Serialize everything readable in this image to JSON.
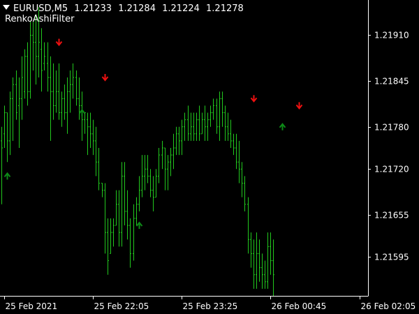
{
  "header": {
    "symbol_timeframe": "EURUSD,M5",
    "open": "1.21233",
    "high": "1.21284",
    "low": "1.21224",
    "close": "1.21278"
  },
  "indicator": {
    "name": "RenkoAshiFilter"
  },
  "colors": {
    "background": "#000000",
    "axis": "#ffffff",
    "text": "#ffffff",
    "bar": "#22c91e",
    "arrow_up": "#0d8a17",
    "arrow_down": "#ee1010"
  },
  "chart_data": {
    "type": "ohlc",
    "ylim": [
      1.2154,
      1.2196
    ],
    "y_ticks": [
      "1.21910",
      "1.21845",
      "1.21780",
      "1.21720",
      "1.21655",
      "1.21595"
    ],
    "x_tick_labels": [
      "25 Feb 2021",
      "25 Feb 22:05",
      "25 Feb 23:25",
      "26 Feb 00:45",
      "26 Feb 02:05"
    ],
    "x_tick_bar_index": [
      1,
      32,
      63,
      94,
      125
    ],
    "grid": false,
    "bars": [
      [
        1.2176,
        1.2178,
        1.2167,
        1.2175
      ],
      [
        1.2177,
        1.2181,
        1.2175,
        1.218
      ],
      [
        1.218,
        1.218,
        1.2173,
        1.2176
      ],
      [
        1.2176,
        1.2183,
        1.2174,
        1.2182
      ],
      [
        1.2182,
        1.2185,
        1.2176,
        1.2184
      ],
      [
        1.2184,
        1.2186,
        1.2179,
        1.218
      ],
      [
        1.2181,
        1.2185,
        1.2175,
        1.2182
      ],
      [
        1.2182,
        1.2188,
        1.2179,
        1.2185
      ],
      [
        1.2183,
        1.2189,
        1.2182,
        1.2188
      ],
      [
        1.2188,
        1.219,
        1.2181,
        1.2183
      ],
      [
        1.2183,
        1.2193,
        1.2182,
        1.2191
      ],
      [
        1.2191,
        1.2193,
        1.2186,
        1.219
      ],
      [
        1.219,
        1.2194,
        1.2184,
        1.2188
      ],
      [
        1.2188,
        1.2195,
        1.2185,
        1.219
      ],
      [
        1.2189,
        1.2192,
        1.2183,
        1.2186
      ],
      [
        1.2187,
        1.219,
        1.2186,
        1.2188
      ],
      [
        1.2187,
        1.219,
        1.2183,
        1.2185
      ],
      [
        1.2185,
        1.2188,
        1.2176,
        1.2183
      ],
      [
        1.2183,
        1.2187,
        1.2179,
        1.2181
      ],
      [
        1.2181,
        1.2186,
        1.218,
        1.2183
      ],
      [
        1.2183,
        1.2187,
        1.2179,
        1.218
      ],
      [
        1.218,
        1.2183,
        1.2178,
        1.2182
      ],
      [
        1.2182,
        1.2184,
        1.2179,
        1.218
      ],
      [
        1.218,
        1.2185,
        1.2177,
        1.2183
      ],
      [
        1.2183,
        1.2186,
        1.218,
        1.2184
      ],
      [
        1.2184,
        1.2187,
        1.2182,
        1.2185
      ],
      [
        1.2185,
        1.2186,
        1.2181,
        1.2182
      ],
      [
        1.2182,
        1.2185,
        1.2179,
        1.2181
      ],
      [
        1.2181,
        1.2183,
        1.2176,
        1.2179
      ],
      [
        1.2179,
        1.218,
        1.2177,
        1.218
      ],
      [
        1.2179,
        1.218,
        1.2174,
        1.2178
      ],
      [
        1.2178,
        1.218,
        1.2175,
        1.2177
      ],
      [
        1.2177,
        1.2179,
        1.2174,
        1.2176
      ],
      [
        1.2176,
        1.2178,
        1.2171,
        1.2173
      ],
      [
        1.2173,
        1.2175,
        1.2169,
        1.217
      ],
      [
        1.217,
        1.217,
        1.2168,
        1.2169
      ],
      [
        1.2169,
        1.217,
        1.216,
        1.2163
      ],
      [
        1.2163,
        1.2165,
        1.2157,
        1.2159
      ],
      [
        1.216,
        1.2165,
        1.216,
        1.2163
      ],
      [
        1.2163,
        1.2165,
        1.2161,
        1.2164
      ],
      [
        1.2164,
        1.2169,
        1.2164,
        1.2167
      ],
      [
        1.2167,
        1.2169,
        1.2161,
        1.2163
      ],
      [
        1.2163,
        1.2173,
        1.2161,
        1.2171
      ],
      [
        1.2171,
        1.2173,
        1.2164,
        1.2166
      ],
      [
        1.2166,
        1.2169,
        1.2162,
        1.2164
      ],
      [
        1.2164,
        1.2165,
        1.2158,
        1.216
      ],
      [
        1.216,
        1.2167,
        1.2159,
        1.2165
      ],
      [
        1.2165,
        1.2168,
        1.2164,
        1.2167
      ],
      [
        1.2167,
        1.2171,
        1.2166,
        1.2169
      ],
      [
        1.2169,
        1.2174,
        1.2168,
        1.2171
      ],
      [
        1.2171,
        1.2174,
        1.2169,
        1.2172
      ],
      [
        1.2172,
        1.2174,
        1.217,
        1.2171
      ],
      [
        1.2171,
        1.2172,
        1.2168,
        1.2169
      ],
      [
        1.2169,
        1.2171,
        1.2166,
        1.2168
      ],
      [
        1.2168,
        1.2172,
        1.2168,
        1.2171
      ],
      [
        1.2171,
        1.2175,
        1.217,
        1.2174
      ],
      [
        1.2174,
        1.2176,
        1.2172,
        1.2175
      ],
      [
        1.2175,
        1.2175,
        1.2169,
        1.2172
      ],
      [
        1.2172,
        1.2174,
        1.2169,
        1.2173
      ],
      [
        1.2173,
        1.2175,
        1.2171,
        1.2174
      ],
      [
        1.2174,
        1.2177,
        1.2172,
        1.2175
      ],
      [
        1.2175,
        1.2178,
        1.2174,
        1.2177
      ],
      [
        1.2177,
        1.2178,
        1.2174,
        1.2176
      ],
      [
        1.2176,
        1.2179,
        1.2174,
        1.2178
      ],
      [
        1.2178,
        1.218,
        1.2176,
        1.2179
      ],
      [
        1.2179,
        1.2181,
        1.2176,
        1.2177
      ],
      [
        1.2177,
        1.218,
        1.2176,
        1.2178
      ],
      [
        1.2178,
        1.218,
        1.2176,
        1.2177
      ],
      [
        1.2177,
        1.218,
        1.2176,
        1.2179
      ],
      [
        1.2179,
        1.2181,
        1.2176,
        1.2177
      ],
      [
        1.2177,
        1.218,
        1.2177,
        1.2179
      ],
      [
        1.2179,
        1.2181,
        1.2176,
        1.2178
      ],
      [
        1.2178,
        1.218,
        1.2176,
        1.2179
      ],
      [
        1.2179,
        1.2181,
        1.2178,
        1.218
      ],
      [
        1.218,
        1.2182,
        1.2179,
        1.2181
      ],
      [
        1.2181,
        1.2182,
        1.2177,
        1.2178
      ],
      [
        1.2178,
        1.2183,
        1.2176,
        1.2182
      ],
      [
        1.2182,
        1.2183,
        1.2178,
        1.218
      ],
      [
        1.218,
        1.2181,
        1.2176,
        1.2178
      ],
      [
        1.2178,
        1.218,
        1.2176,
        1.2177
      ],
      [
        1.2177,
        1.2179,
        1.2175,
        1.2176
      ],
      [
        1.2176,
        1.2177,
        1.2174,
        1.2175
      ],
      [
        1.2175,
        1.2177,
        1.2172,
        1.2173
      ],
      [
        1.2173,
        1.2176,
        1.217,
        1.2172
      ],
      [
        1.2172,
        1.2173,
        1.2168,
        1.217
      ],
      [
        1.217,
        1.2171,
        1.2166,
        1.2167
      ],
      [
        1.2167,
        1.2168,
        1.216,
        1.2162
      ],
      [
        1.2162,
        1.2163,
        1.2158,
        1.216
      ],
      [
        1.216,
        1.2162,
        1.2155,
        1.2157
      ],
      [
        1.2157,
        1.2163,
        1.2155,
        1.216
      ],
      [
        1.216,
        1.2162,
        1.2156,
        1.2158
      ],
      [
        1.2158,
        1.216,
        1.2155,
        1.2157
      ],
      [
        1.2157,
        1.2159,
        1.2155,
        1.2156
      ],
      [
        1.2156,
        1.2163,
        1.2155,
        1.2161
      ],
      [
        1.2161,
        1.2163,
        1.2157,
        1.2159
      ],
      [
        1.2159,
        1.2162,
        1.2154,
        1.2157
      ]
    ],
    "signals": [
      {
        "type": "buy",
        "bar": 2,
        "price": 1.2171
      },
      {
        "type": "sell",
        "bar": 20,
        "price": 1.219
      },
      {
        "type": "sell",
        "bar": 36,
        "price": 1.2185
      },
      {
        "type": "buy",
        "bar": 28,
        "price": 1.218
      },
      {
        "type": "buy",
        "bar": 48,
        "price": 1.2164
      },
      {
        "type": "sell",
        "bar": 88,
        "price": 1.2182
      },
      {
        "type": "buy",
        "bar": 98,
        "price": 1.2178
      },
      {
        "type": "sell",
        "bar": 104,
        "price": 1.2181
      }
    ]
  }
}
